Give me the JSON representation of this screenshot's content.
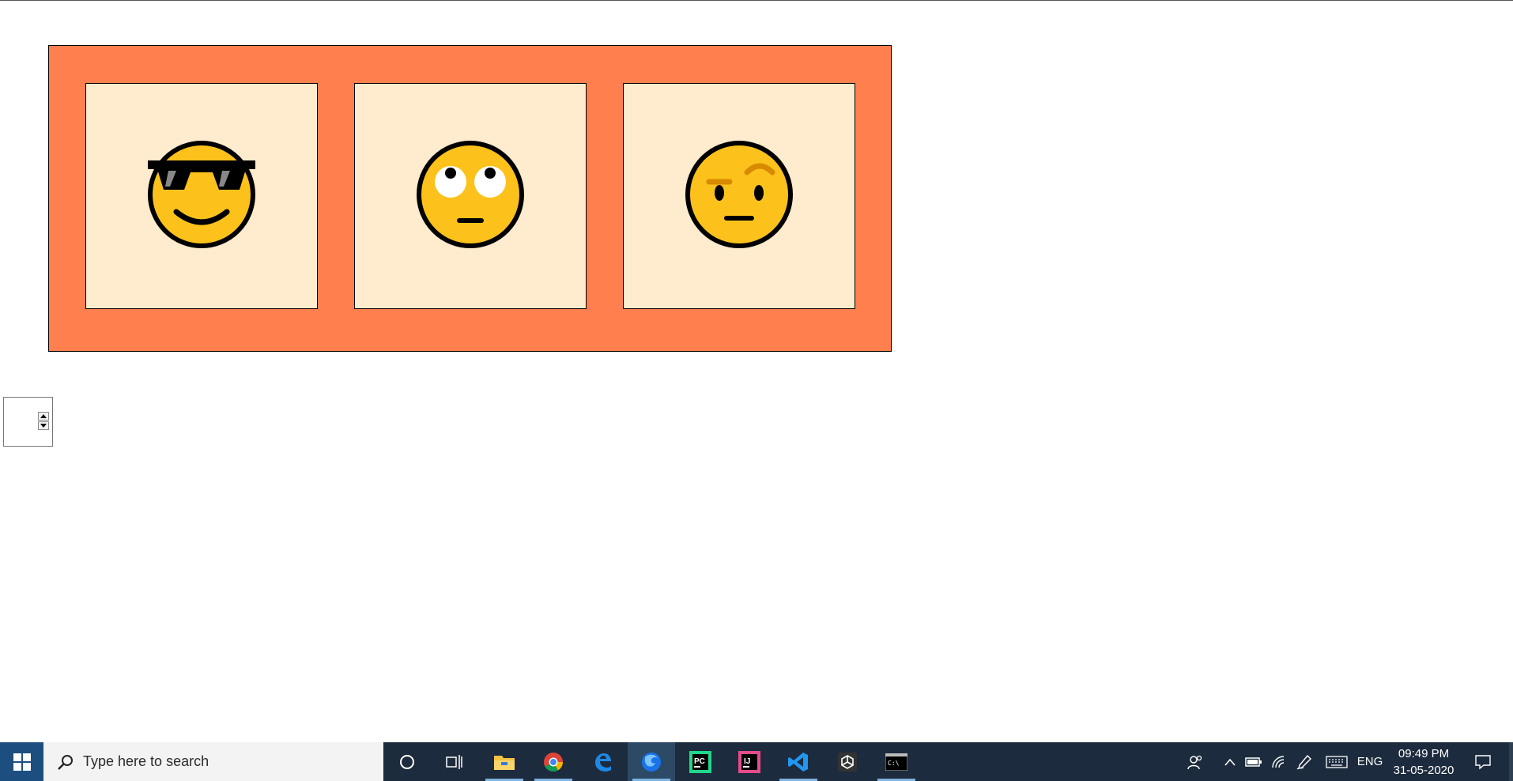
{
  "emojis": [
    {
      "name": "smiling-face-with-sunglasses"
    },
    {
      "name": "face-with-rolling-eyes"
    },
    {
      "name": "face-with-raised-eyebrow"
    }
  ],
  "colors": {
    "frame": "#ff7f4f",
    "card": "#ffebcd",
    "face": "#fcc21b",
    "taskbar": "#1c2b3d"
  },
  "spinner": {
    "value": ""
  },
  "taskbar": {
    "search_placeholder": "Type here to search",
    "apps": [
      "cortana-icon",
      "task-view-icon",
      "file-explorer-icon",
      "chrome-icon",
      "edge-icon",
      "firefox-icon",
      "pycharm-icon",
      "intellij-icon",
      "vscode-icon",
      "unity-icon",
      "terminal-icon"
    ],
    "language": "ENG",
    "time": "09:49 PM",
    "date": "31-05-2020"
  }
}
